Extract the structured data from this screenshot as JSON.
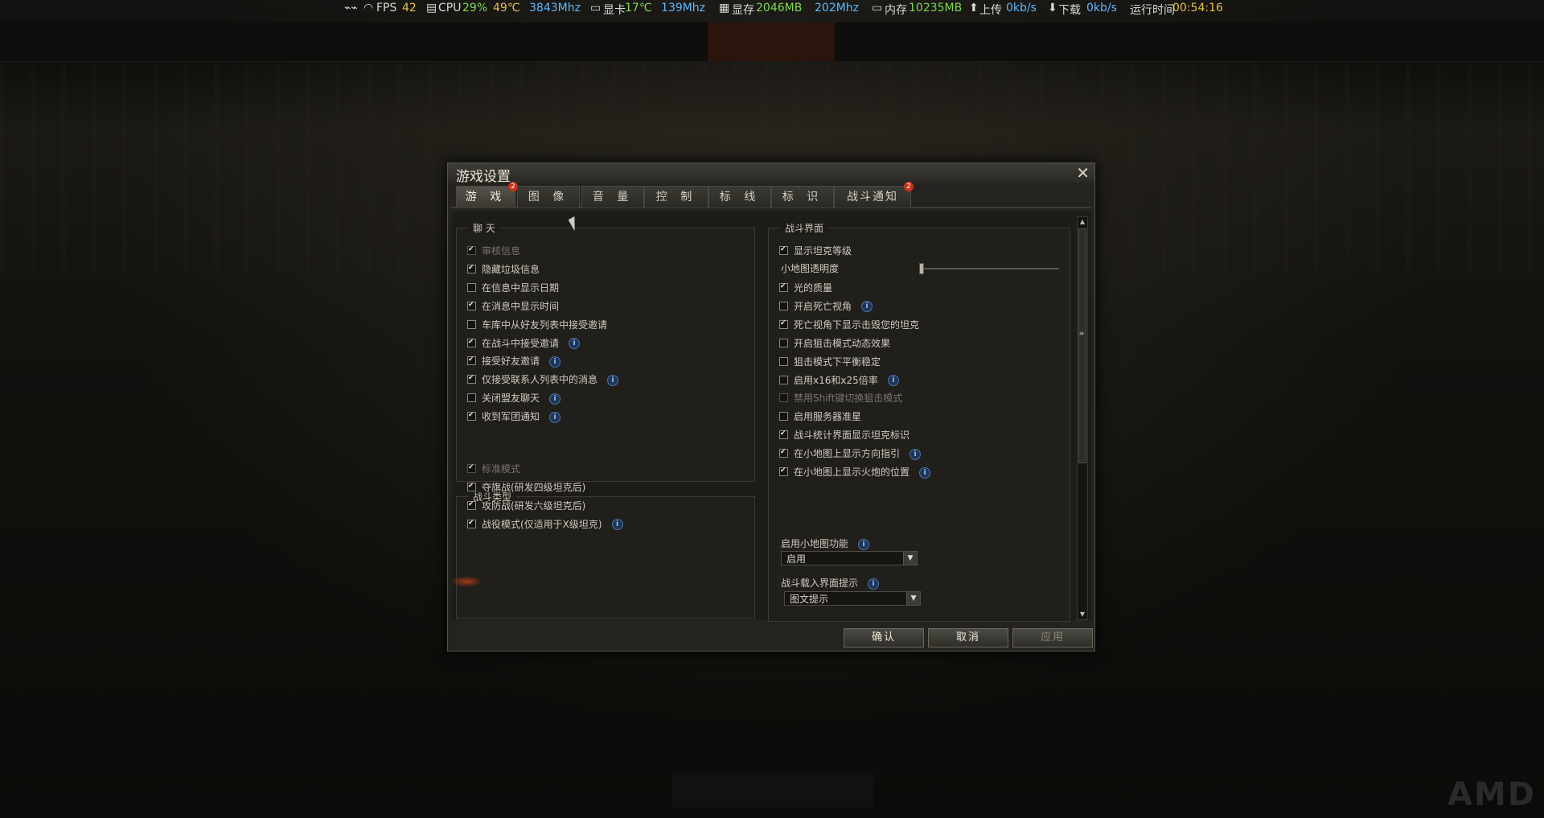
{
  "osd": {
    "fps_label": "FPS",
    "fps": "42",
    "cpu_label": "CPU",
    "cpu_usage": "29%",
    "cpu_temp": "49℃",
    "cpu_clock": "3843Mhz",
    "gpu_label": "显卡",
    "gpu_temp": "17℃",
    "gpu_clock": "139Mhz",
    "vram_label": "显存",
    "vram": "2046MB",
    "vram_clock": "202Mhz",
    "ram_label": "内存",
    "ram": "10235MB",
    "upload_label": "上传",
    "upload": "0kb/s",
    "download_label": "下载",
    "download": "0kb/s",
    "runtime_label": "运行时间",
    "runtime": "00:54:16"
  },
  "dialog": {
    "title": "游戏设置",
    "close_glyph": "✕",
    "tabs": [
      {
        "label": "游 戏",
        "badge": "2"
      },
      {
        "label": "图 像",
        "badge": ""
      },
      {
        "label": "音 量",
        "badge": ""
      },
      {
        "label": "控 制",
        "badge": ""
      },
      {
        "label": "标 线",
        "badge": ""
      },
      {
        "label": "标 识",
        "badge": ""
      },
      {
        "label": "战斗通知",
        "badge": "2"
      }
    ],
    "chat": {
      "title": "聊 天",
      "options": [
        {
          "label": "审核信息",
          "checked": true,
          "disabled": true,
          "info": false
        },
        {
          "label": "隐藏垃圾信息",
          "checked": true,
          "disabled": false,
          "info": false
        },
        {
          "label": "在信息中显示日期",
          "checked": false,
          "disabled": false,
          "info": false
        },
        {
          "label": "在消息中显示时间",
          "checked": true,
          "disabled": false,
          "info": false
        },
        {
          "label": "车库中从好友列表中接受邀请",
          "checked": false,
          "disabled": false,
          "info": false
        },
        {
          "label": "在战斗中接受邀请",
          "checked": true,
          "disabled": false,
          "info": true
        },
        {
          "label": "接受好友邀请",
          "checked": true,
          "disabled": false,
          "info": true
        },
        {
          "label": "仅接受联系人列表中的消息",
          "checked": true,
          "disabled": false,
          "info": true
        },
        {
          "label": "关闭盟友聊天",
          "checked": false,
          "disabled": false,
          "info": true
        },
        {
          "label": "收到军团通知",
          "checked": true,
          "disabled": false,
          "info": true
        }
      ]
    },
    "battle_types": {
      "title": "战斗类型",
      "options": [
        {
          "label": "标准模式",
          "checked": true,
          "disabled": true,
          "info": false
        },
        {
          "label": "夺旗战(研发四级坦克后)",
          "checked": true,
          "disabled": false,
          "info": false
        },
        {
          "label": "攻防战(研发六级坦克后)",
          "checked": true,
          "disabled": false,
          "info": false
        },
        {
          "label": "战役模式(仅适用于X级坦克)",
          "checked": true,
          "disabled": false,
          "info": true
        }
      ]
    },
    "battle_ui": {
      "title": "战斗界面",
      "show_tank_tier": "显示坦克等级",
      "minimap_opacity_label": "小地图透明度",
      "minimap_opacity_value": 0.0,
      "options": [
        {
          "label": "光的质量",
          "checked": true,
          "disabled": false,
          "info": false
        },
        {
          "label": "开启死亡视角",
          "checked": false,
          "disabled": false,
          "info": true
        },
        {
          "label": "死亡视角下显示击毁您的坦克",
          "checked": true,
          "disabled": false,
          "info": false
        },
        {
          "label": "开启狙击模式动态效果",
          "checked": false,
          "disabled": false,
          "info": false
        },
        {
          "label": "狙击模式下平衡稳定",
          "checked": false,
          "disabled": false,
          "info": false
        },
        {
          "label": "启用x16和x25倍率",
          "checked": false,
          "disabled": false,
          "info": true
        },
        {
          "label": "禁用Shift键切换狙击模式",
          "checked": false,
          "disabled": true,
          "info": false
        },
        {
          "label": "启用服务器准星",
          "checked": false,
          "disabled": false,
          "info": false
        },
        {
          "label": "战斗统计界面显示坦克标识",
          "checked": true,
          "disabled": false,
          "info": false
        },
        {
          "label": "在小地图上显示方向指引",
          "checked": true,
          "disabled": false,
          "info": true
        },
        {
          "label": "在小地图上显示火炮的位置",
          "checked": true,
          "disabled": false,
          "info": true
        }
      ],
      "minimap_feature_label": "启用小地图功能",
      "minimap_feature_value": "启用",
      "loading_hint_label": "战斗载入界面提示",
      "loading_hint_value": "图文提示"
    },
    "buttons": {
      "confirm": "确认",
      "cancel": "取消",
      "apply": "应用"
    }
  }
}
